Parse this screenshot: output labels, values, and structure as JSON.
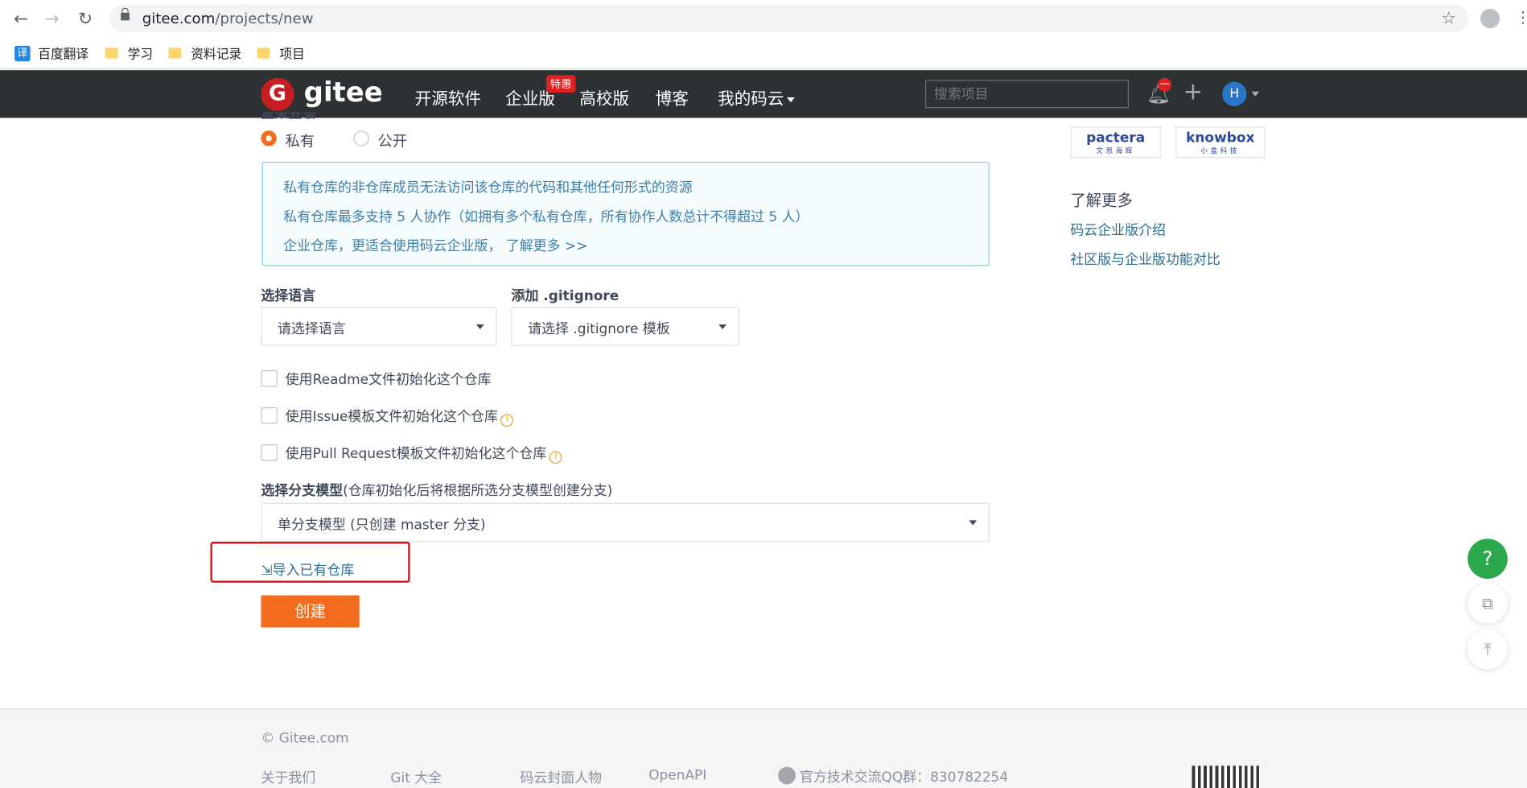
{
  "browser": {
    "url_host": "gitee.com",
    "url_path": "/projects/new",
    "bookmarks": [
      "百度翻译",
      "学习",
      "资料记录",
      "项目"
    ],
    "translate_icon": "译"
  },
  "header": {
    "logo_text": "gitee",
    "logo_mark": "G",
    "nav": [
      "开源软件",
      "企业版",
      "高校版",
      "博客",
      "我的码云"
    ],
    "badge": "特惠",
    "search_placeholder": "搜索项目",
    "notif_count": "—",
    "avatar_letter": "H"
  },
  "form": {
    "visibility_label": "是否开源",
    "radio_private": "私有",
    "radio_public": "公开",
    "info": [
      "私有仓库的非仓库成员无法访问该仓库的代码和其他任何形式的资源",
      "私有仓库最多支持 5 人协作（如拥有多个私有仓库，所有协作人数总计不得超过 5 人）",
      "企业仓库，更适合使用码云企业版， 了解更多 >>"
    ],
    "lang_label": "选择语言",
    "lang_select": "请选择语言",
    "gitignore_label": "添加 .gitignore",
    "gitignore_select": "请选择 .gitignore 模板",
    "checkboxes": [
      "使用Readme文件初始化这个仓库",
      "使用Issue模板文件初始化这个仓库",
      "使用Pull Request模板文件初始化这个仓库"
    ],
    "branch_label": "选择分支模型",
    "branch_hint": "(仓库初始化后将根据所选分支模型创建分支)",
    "branch_select": "单分支模型 (只创建 master 分支)",
    "import_link": "导入已有仓库",
    "create_button": "创建"
  },
  "sidebar": {
    "sponsors": [
      {
        "name": "pactera",
        "sub": "文思海辉"
      },
      {
        "name": "knowbox",
        "sub": "小盒科技"
      }
    ],
    "more_title": "了解更多",
    "links": [
      "码云企业版介绍",
      "社区版与企业版功能对比"
    ]
  },
  "float": {
    "help": "?"
  },
  "footer": {
    "copyright": "© Gitee.com",
    "links": [
      "关于我们",
      "Git 大全",
      "码云封面人物",
      "OpenAPI"
    ],
    "qq": "官方技术交流QQ群：830782254"
  }
}
